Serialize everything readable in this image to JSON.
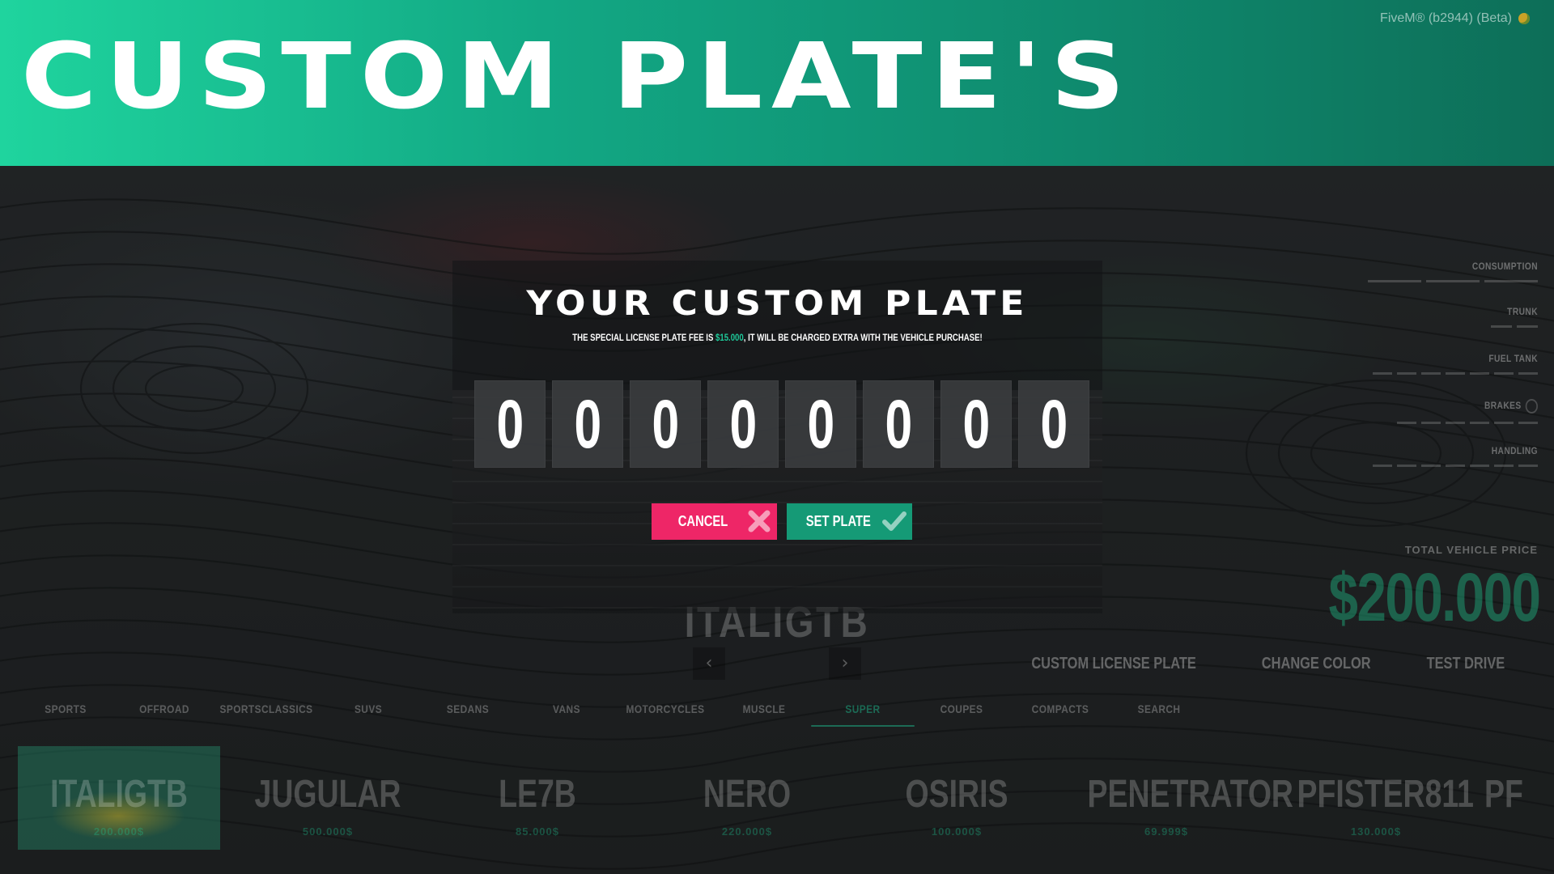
{
  "banner": {
    "title": "CUSTOM PLATE'S"
  },
  "client": {
    "version_label": "FiveM® (b2944) (Beta)",
    "logo_icon": "fivem-logo-icon"
  },
  "stats": [
    {
      "label": "CONSUMPTION",
      "icon": ""
    },
    {
      "label": "TRUNK",
      "icon": "trunk-icon"
    },
    {
      "label": "FUEL TANK",
      "icon": "fuel-icon"
    },
    {
      "label": "BRAKES",
      "icon": "brake-icon"
    },
    {
      "label": "HANDLING",
      "icon": "steering-icon"
    }
  ],
  "price": {
    "label": "TOTAL VEHICLE PRICE",
    "value": "$200.000"
  },
  "actions": {
    "custom_plate": "CUSTOM LICENSE PLATE",
    "change_color": "CHANGE COLOR",
    "test_drive": "TEST DRIVE"
  },
  "vehicle": {
    "name": "ITALIGTB",
    "prev_icon": "chevron-left-icon",
    "next_icon": "chevron-right-icon"
  },
  "categories": [
    "SPORTS",
    "OFFROAD",
    "SPORTSCLASSICS",
    "SUVS",
    "SEDANS",
    "VANS",
    "MOTORCYCLES",
    "MUSCLE",
    "SUPER",
    "COUPES",
    "COMPACTS",
    "SEARCH"
  ],
  "active_category": "SUPER",
  "cars": [
    {
      "name": "ITALIGTB",
      "price": "200.000$"
    },
    {
      "name": "JUGULAR",
      "price": "500.000$"
    },
    {
      "name": "LE7B",
      "price": "85.000$"
    },
    {
      "name": "NERO",
      "price": "220.000$"
    },
    {
      "name": "OSIRIS",
      "price": "100.000$"
    },
    {
      "name": "PENETRATOR",
      "price": "69.999$"
    },
    {
      "name": "PFISTER811",
      "price": "130.000$"
    },
    {
      "name": "PF",
      "price": ""
    }
  ],
  "modal": {
    "title": "YOUR CUSTOM PLATE",
    "subtitle_before": "THE SPECIAL LICENSE PLATE FEE IS ",
    "fee": "$15.000",
    "subtitle_after": ", IT WILL BE CHARGED EXTRA WITH THE VEHICLE PURCHASE!",
    "plate_digits": [
      "0",
      "0",
      "0",
      "0",
      "0",
      "0",
      "0",
      "0"
    ],
    "cancel_label": "CANCEL",
    "cancel_icon": "close-icon",
    "set_label": "SET PLATE",
    "set_icon": "check-icon"
  },
  "colors": {
    "accent": "#1fc99a",
    "cancel": "#ee2667",
    "set": "#159a76",
    "banner_start": "#1fd49e",
    "banner_end": "#0d6e58"
  }
}
